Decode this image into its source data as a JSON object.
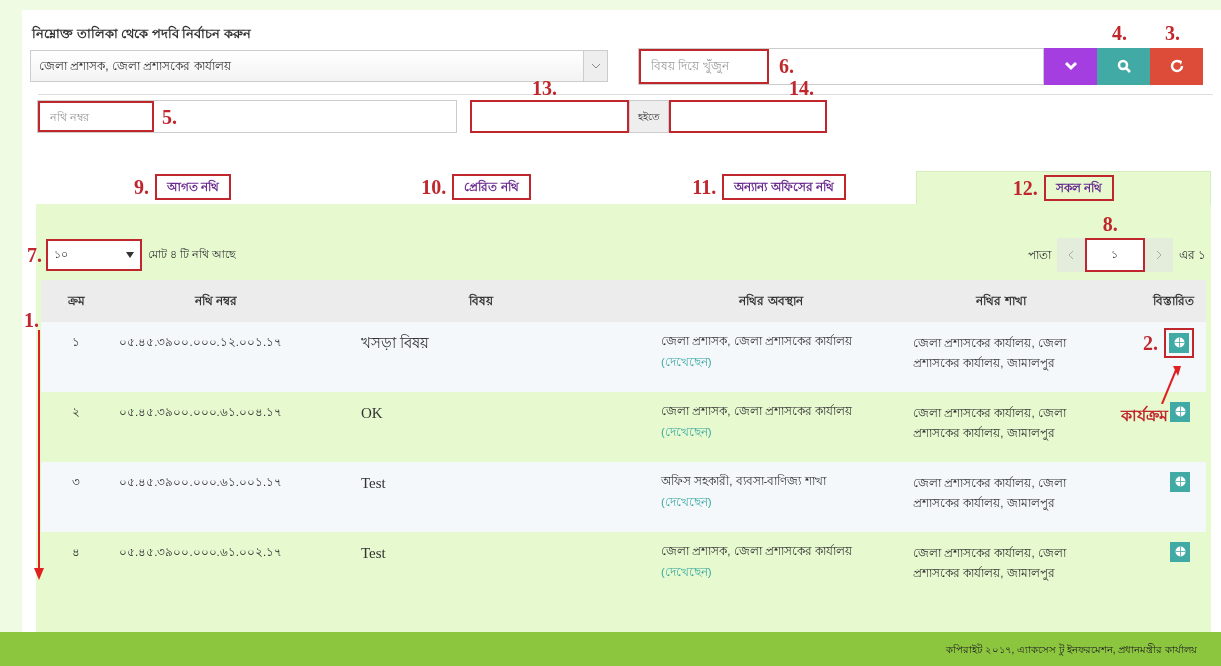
{
  "designation": {
    "label": "নিম্নোক্ত তালিকা থেকে পদবি নির্বাচন করুন",
    "value": "জেলা প্রশাসক, জেলা প্রশাসকের কার্যালয়"
  },
  "subject_search": {
    "placeholder": "বিষয় দিয়ে খুঁজুন",
    "annotation": "6."
  },
  "action_buttons": [
    {
      "kind": "dropdown"
    },
    {
      "kind": "search",
      "annotation": "4."
    },
    {
      "kind": "reset",
      "annotation": "3."
    }
  ],
  "file_number": {
    "placeholder": "নথি নম্বর",
    "annotation": "5."
  },
  "date_from": {
    "annotation": "13."
  },
  "date_separator": "হইতে",
  "date_to": {
    "annotation": "14."
  },
  "tabs": [
    {
      "label": "আগত নথি",
      "annotation": "9.",
      "selected": false
    },
    {
      "label": "প্রেরিত নথি",
      "annotation": "10.",
      "selected": false
    },
    {
      "label": "অন্যান্য অফিসের নথি",
      "annotation": "11.",
      "selected": false
    },
    {
      "label": "সকল নথি",
      "annotation": "12.",
      "selected": true
    }
  ],
  "page_size": {
    "value": "১০",
    "annotation": "7."
  },
  "total_text": "মোট ৪ টি নথি আছে",
  "pagination": {
    "label": "পাতা",
    "current": "১",
    "annotation": "8.",
    "of_text": "এর ১"
  },
  "table": {
    "annotation": "1.",
    "columns": [
      "ক্রম",
      "নথি নম্বর",
      "বিষয়",
      "নথির অবস্থান",
      "নথির শাখা",
      "বিস্তারিত"
    ],
    "rows": [
      {
        "serial": "১",
        "number": "০৫.৪৫.৩৯০০.০০০.১২.০০১.১৭",
        "subject": "খসড়া বিষয়",
        "location": "জেলা প্রশাসক, জেলা প্রশাসকের কার্যালয়",
        "status": "(দেখেছেন)",
        "branch": "জেলা প্রশাসকের কার্যালয়, জেলা প্রশাসকের কার্যালয়, জামালপুর",
        "annotation": "2.",
        "caption": "কার্যক্রম"
      },
      {
        "serial": "২",
        "number": "০৫.৪৫.৩৯০০.০০০.৬১.০০৪.১৭",
        "subject": "OK",
        "location": "জেলা প্রশাসক, জেলা প্রশাসকের কার্যালয়",
        "status": "(দেখেছেন)",
        "branch": "জেলা প্রশাসকের কার্যালয়, জেলা প্রশাসকের কার্যালয়, জামালপুর"
      },
      {
        "serial": "৩",
        "number": "০৫.৪৫.৩৯০০.০০০.৬১.০০১.১৭",
        "subject": "Test",
        "location": "অফিস সহকারী, ব্যবসা-বাণিজ্য শাখা",
        "status": "(দেখেছেন)",
        "branch": "জেলা প্রশাসকের কার্যালয়, জেলা প্রশাসকের কার্যালয়, জামালপুর"
      },
      {
        "serial": "৪",
        "number": "০৫.৪৫.৩৯০০.০০০.৬১.০০২.১৭",
        "subject": "Test",
        "location": "জেলা প্রশাসক, জেলা প্রশাসকের কার্যালয়",
        "status": "(দেখেছেন)",
        "branch": "জেলা প্রশাসকের কার্যালয়, জেলা প্রশাসকের কার্যালয়, জামালপুর"
      }
    ]
  },
  "footer": "কপিরাইট ২০১৭, এ্যাকসেস টু ইনফরমেশন, প্রধানমন্ত্রীর কার্যালয়"
}
